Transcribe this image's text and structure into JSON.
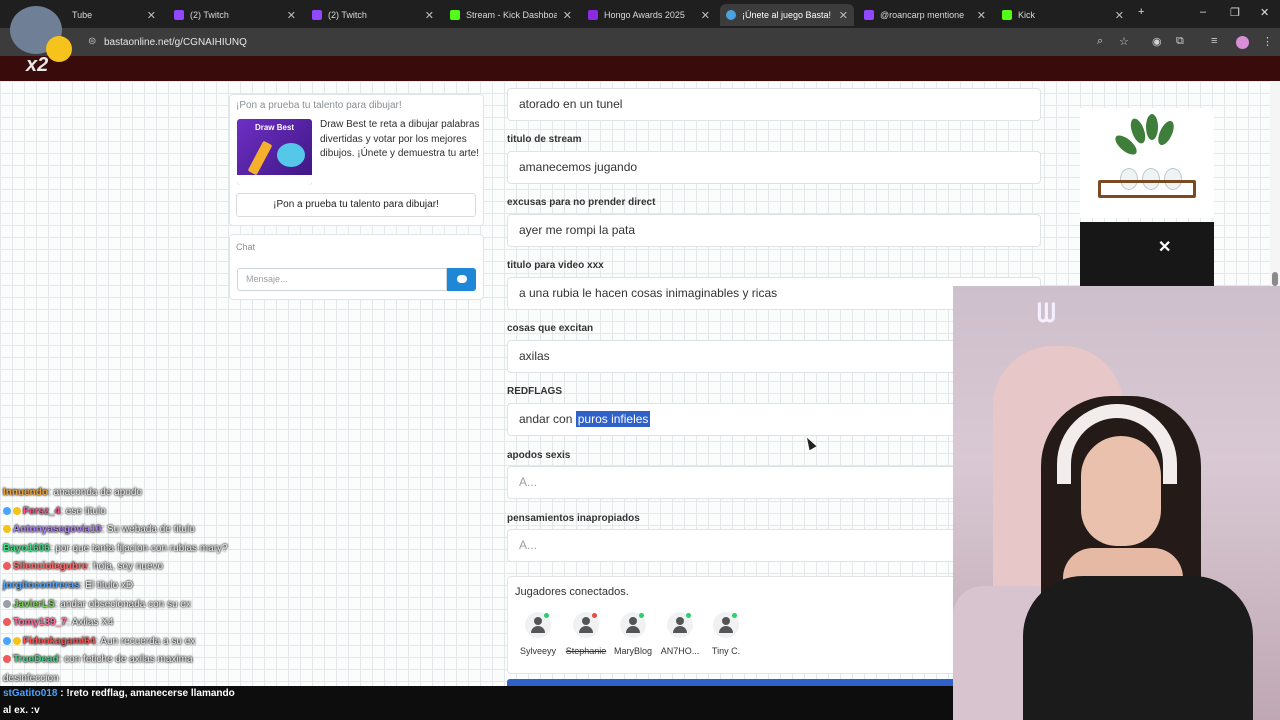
{
  "browser": {
    "tabs": [
      {
        "label": "Tube",
        "color": "#ff0000"
      },
      {
        "label": "(2) Twitch",
        "color": "#9146ff"
      },
      {
        "label": "(2) Twitch",
        "color": "#9146ff"
      },
      {
        "label": "Stream - Kick Dashboard",
        "color": "#53fc18"
      },
      {
        "label": "Hongo Awards 2025",
        "color": "#8a2be2"
      },
      {
        "label": "¡Únete al juego Basta!",
        "color": "#4aa3df"
      },
      {
        "label": "@roancarp mentione",
        "color": "#9146ff"
      },
      {
        "label": "Kick",
        "color": "#53fc18"
      }
    ],
    "new_tab": "+",
    "url": "bastaonline.net/g/CGNAIHIUNQ",
    "window_controls": [
      "–",
      "❐",
      "✕"
    ]
  },
  "promo": {
    "heading": "¡Pon a prueba tu talento para dibujar!",
    "image_title": "Draw Best",
    "text": "Draw Best te reta a dibujar palabras divertidas y votar por los mejores dibujos. ¡Únete y demuestra tu arte!",
    "button": "¡Pon a prueba tu talento para dibujar!"
  },
  "chat": {
    "title": "Chat",
    "placeholder": "Mensaje..."
  },
  "form": {
    "first_value": "atorado en un tunel",
    "fields": [
      {
        "label": "titulo de stream",
        "value": "amanecemos jugando",
        "placeholder": false
      },
      {
        "label": "excusas para no prender direct",
        "value": "ayer me rompi la pata",
        "placeholder": false
      },
      {
        "label": "titulo para video xxx",
        "value": "a una rubia le hacen cosas inimaginables y ricas",
        "placeholder": false
      },
      {
        "label": "cosas que excitan",
        "value": "axilas",
        "placeholder": false
      },
      {
        "label": "REDFLAGS",
        "value_prefix": "andar con ",
        "value_selected": "puros infieles",
        "placeholder": false
      },
      {
        "label": "apodos sexis",
        "value": "A...",
        "placeholder": true
      },
      {
        "label": "pensamientos inapropiados",
        "value": "A...",
        "placeholder": true
      }
    ]
  },
  "players": {
    "title": "Jugadores conectados.",
    "list": [
      {
        "name": "Sylveeyy",
        "status_color": "#2ecc71"
      },
      {
        "name": "Stephanie",
        "status_color": "#e74c3c"
      },
      {
        "name": "MaryBlog",
        "status_color": "#2ecc71"
      },
      {
        "name": "AN7HO...",
        "status_color": "#2ecc71"
      },
      {
        "name": "Tiny C.",
        "status_color": "#2ecc71"
      }
    ]
  },
  "ad": {
    "close": "✕"
  },
  "overlay": {
    "emote_text": "x2"
  },
  "twitch_chat": [
    {
      "user": "Innuendo",
      "color": "#e8a33d",
      "text": ": anaconda de apodo"
    },
    {
      "user": "Fersz_4",
      "color": "#ff4d8d",
      "text": ": ese titulo"
    },
    {
      "user": "Antonyasegovia10",
      "color": "#b07cff",
      "text": ": Su webada de titulo"
    },
    {
      "user": "Bayo1606",
      "color": "#3ddc84",
      "text": ": por que tanta fijacion con rubias mary?"
    },
    {
      "user": "Silenciolegubre",
      "color": "#ff6b6b",
      "text": ": hola, soy nuevo"
    },
    {
      "user": "jorgitocontreras",
      "color": "#4aa3ff",
      "text": ": El titulo xD"
    },
    {
      "user": "JavierLS",
      "color": "#7bd15a",
      "text": ": andar obsecionada con su ex"
    },
    {
      "user": "Tomy139_7",
      "color": "#ff6b9a",
      "text": ": Axilas X4"
    },
    {
      "user": "Fideokagami64",
      "color": "#ff4d4d",
      "text": ": Aun recuerda a su ex"
    },
    {
      "user": "TrueDead",
      "color": "#3ddc84",
      "text": ": con fetiche de axilas maxima"
    },
    {
      "user": "",
      "color": "#e9e9e9",
      "text": "desinfeccion"
    }
  ],
  "bottom_chat": {
    "user": "stGatito018",
    "line1": " : !reto redflag, amanecerse llamando",
    "line2": "al ex. :v"
  }
}
